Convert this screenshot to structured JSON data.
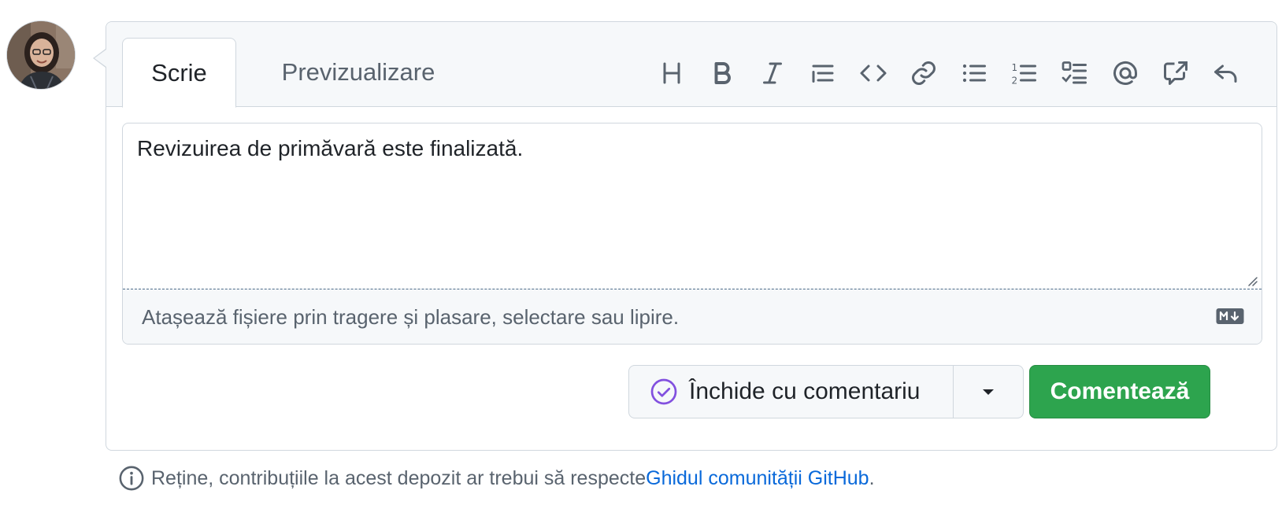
{
  "tabs": {
    "write": "Scrie",
    "preview": "Previzualizare"
  },
  "toolbar": {
    "icons": [
      "heading-icon",
      "bold-icon",
      "italic-icon",
      "quote-icon",
      "code-icon",
      "link-icon",
      "unordered-list-icon",
      "ordered-list-icon",
      "task-list-icon",
      "mention-icon",
      "cross-reference-icon",
      "reply-icon"
    ]
  },
  "editor": {
    "value": "Revizuirea de primăvară este finalizată."
  },
  "attach": {
    "text": "Atașează fișiere prin tragere și plasare, selectare sau lipire."
  },
  "actions": {
    "close_label": "Închide cu comentariu",
    "comment_label": "Comentează"
  },
  "footer": {
    "prefix": "Reține, contribuțiile la acest depozit ar trebui să respecte ",
    "link": "Ghidul comunității GitHub",
    "suffix": "."
  },
  "colors": {
    "accent_green": "#2da44e",
    "link_blue": "#0969da",
    "closed_purple": "#8250df"
  }
}
